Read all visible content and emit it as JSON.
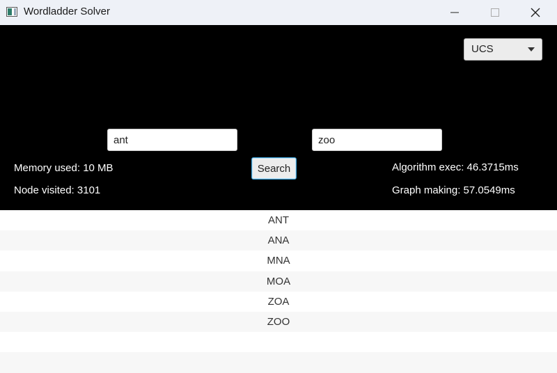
{
  "window": {
    "title": "Wordladder Solver"
  },
  "algorithm": {
    "selected": "UCS"
  },
  "inputs": {
    "start_word": "ant",
    "end_word": "zoo"
  },
  "search_button": {
    "label": "Search"
  },
  "stats": {
    "memory": "Memory used: 10 MB",
    "nodes": "Node visited: 3101",
    "algorithm_exec": "Algorithm exec: 46.3715ms",
    "graph_making": "Graph making: 57.0549ms"
  },
  "results": [
    "ANT",
    "ANA",
    "MNA",
    "MOA",
    "ZOA",
    "ZOO"
  ]
}
